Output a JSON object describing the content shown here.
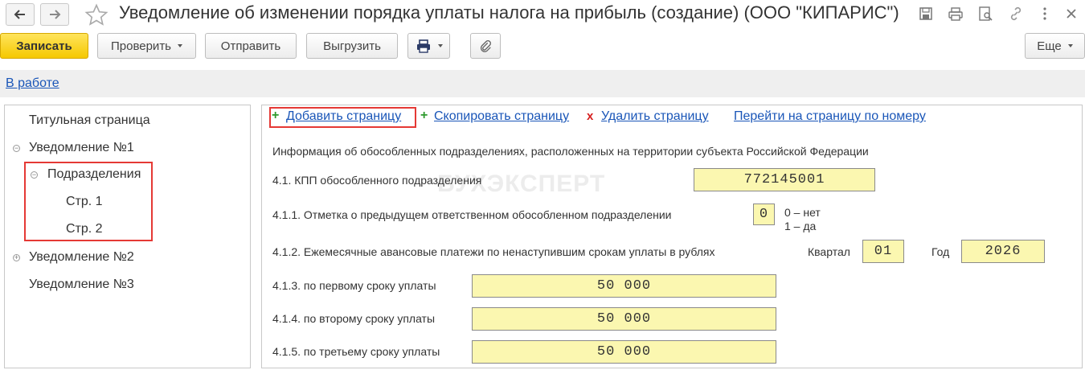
{
  "window": {
    "title": "Уведомление об изменении порядка уплаты налога на прибыль (создание) (ООО \"КИПАРИС\")"
  },
  "toolbar": {
    "save_label": "Записать",
    "check_label": "Проверить",
    "send_label": "Отправить",
    "export_label": "Выгрузить",
    "more_label": "Еще"
  },
  "status": {
    "label": "В работе"
  },
  "tree": {
    "items": [
      {
        "label": "Титульная страница"
      },
      {
        "label": "Уведомление №1"
      },
      {
        "label": "Подразделения"
      },
      {
        "label": "Стр. 1"
      },
      {
        "label": "Стр. 2"
      },
      {
        "label": "Уведомление №2"
      },
      {
        "label": "Уведомление №3"
      }
    ]
  },
  "page_actions": {
    "add_label": "Добавить страницу",
    "copy_label": "Скопировать страницу",
    "delete_label": "Удалить страницу",
    "goto_label": "Перейти на страницу по номеру"
  },
  "form": {
    "section_title": "Информация об обособленных подразделениях, расположенных на территории субъекта Российской Федерации",
    "kpp_label": "4.1. КПП обособленного подразделения",
    "kpp_value": "772145001",
    "prev_mark_label": "4.1.1. Отметка о предыдущем ответственном обособленном подразделении",
    "prev_mark_value": "0",
    "prev_mark_hint_no": "0 – нет",
    "prev_mark_hint_yes": "1 – да",
    "monthly_label": "4.1.2. Ежемесячные авансовые платежи по ненаступившим срокам уплаты в рублях",
    "quarter_label": "Квартал",
    "quarter_value": "01",
    "year_label": "Год",
    "year_value": "2026",
    "first_label": "4.1.3. по первому сроку уплаты",
    "first_value": "50 000",
    "second_label": "4.1.4. по второму сроку уплаты",
    "second_value": "50 000",
    "third_label": "4.1.5. по третьему сроку уплаты",
    "third_value": "50 000"
  },
  "watermark": {
    "text": "БУХЭКСПЕРТ"
  }
}
